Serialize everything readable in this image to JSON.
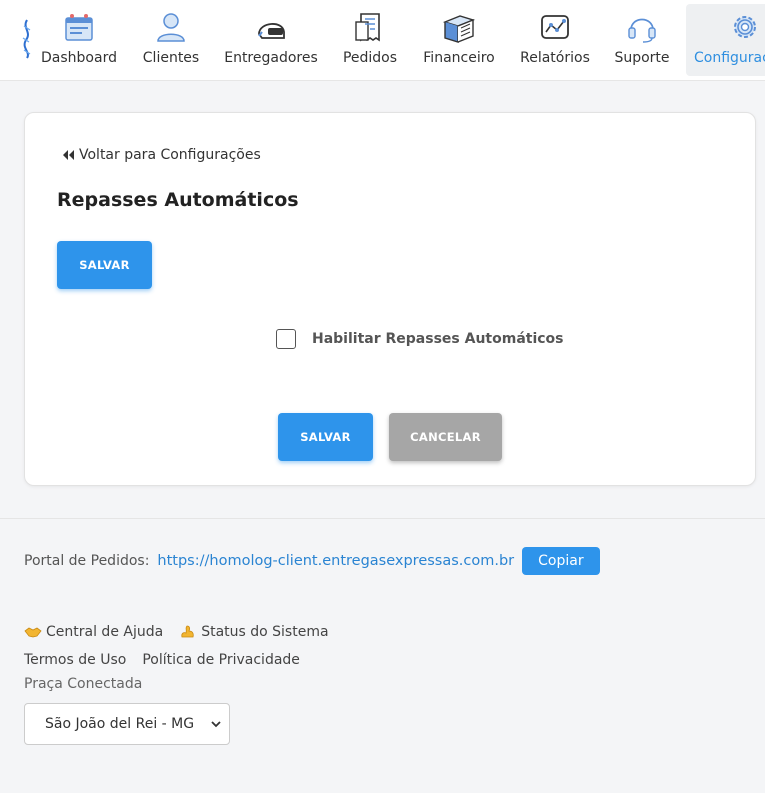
{
  "nav": {
    "items": [
      {
        "label": "Dashboard",
        "icon": "dashboard-icon"
      },
      {
        "label": "Clientes",
        "icon": "user-icon"
      },
      {
        "label": "Entregadores",
        "icon": "helmet-icon"
      },
      {
        "label": "Pedidos",
        "icon": "receipt-icon"
      },
      {
        "label": "Financeiro",
        "icon": "books-icon"
      },
      {
        "label": "Relatórios",
        "icon": "chart-icon"
      },
      {
        "label": "Suporte",
        "icon": "headset-icon"
      },
      {
        "label": "Configurações",
        "icon": "gear-icon",
        "active": true
      }
    ],
    "active_color": "#2f8fe0"
  },
  "card": {
    "back_link": "Voltar para Configurações",
    "title": "Repasses Automáticos",
    "save_top_label": "SALVAR",
    "checkbox_label": "Habilitar Repasses Automáticos",
    "checkbox_checked": false,
    "save_label": "SALVAR",
    "cancel_label": "CANCELAR"
  },
  "footer": {
    "portal_label": "Portal de Pedidos:",
    "portal_url": "https://homolog-client.entregasexpressas.com.br",
    "copy_label": "Copiar",
    "help_center": "Central de Ajuda",
    "system_status": "Status do Sistema",
    "terms": "Termos de Uso",
    "privacy": "Política de Privacidade",
    "praca_label": "Praça Conectada",
    "praca_selected": "São João del Rei - MG"
  },
  "colors": {
    "primary": "#2e94eb",
    "gray_button": "#a6a6a6",
    "link": "#2a84d2"
  }
}
